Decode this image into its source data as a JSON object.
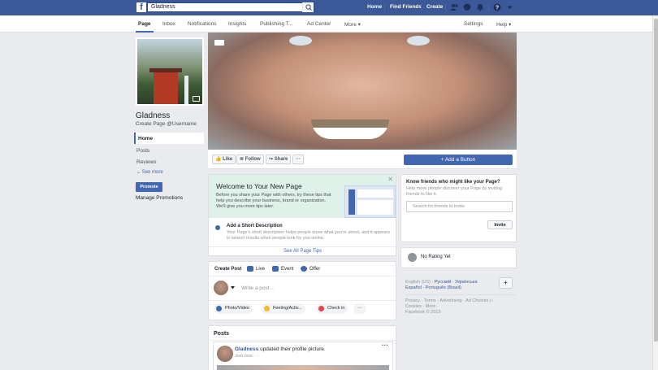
{
  "topbar": {
    "logo": "f",
    "search_value": "Gladness",
    "nav": [
      "Home",
      "Find Friends",
      "Create"
    ],
    "icons": [
      "friend-requests-icon",
      "messenger-icon",
      "notifications-icon",
      "help-icon",
      "account-menu-icon"
    ]
  },
  "subnav": {
    "tabs": [
      "Page",
      "Inbox",
      "Notifications",
      "Insights",
      "Publishing T...",
      "Ad Center",
      "More ▾"
    ],
    "settings": "Settings",
    "help": "Help ▾"
  },
  "sidebar": {
    "page_name": "Gladness",
    "username": "Create Page @Username",
    "items": [
      "Home",
      "Posts",
      "Reviews"
    ],
    "see_more": "See more",
    "promote": "Promote",
    "manage": "Manage Promotions"
  },
  "actions": {
    "like": "Like",
    "follow": "Follow",
    "share": "Share",
    "more": "···",
    "add_button": "+ Add a Button"
  },
  "welcome": {
    "title": "Welcome to Your New Page",
    "text": "Before you share your Page with others, try these tips that help you describe your business, brand or organization. We'll give you more tips later.",
    "tip_title": "Add a Short Description",
    "tip_text": "Your Page's short description helps people know what you're about, and it appears in search results when people look for you online.",
    "see_all": "See All Page Tips",
    "close": "✕"
  },
  "composer": {
    "tabs": [
      "Create Post",
      "Live",
      "Event",
      "Offer"
    ],
    "placeholder": "Write a post...",
    "options": [
      "Photo/Video",
      "Feeling/Activ...",
      "Check in",
      "···"
    ]
  },
  "posts": {
    "title": "Posts",
    "author": "Gladness",
    "action": "updated their profile picture.",
    "time": "Just now",
    "more": "···"
  },
  "right": {
    "invite_title": "Know friends who might like your Page?",
    "invite_text": "Help more people discover your Page by inviting friends to like it.",
    "search_placeholder": "Search for friends to invite",
    "invite_btn": "Invite",
    "rating": "No Rating Yet",
    "lang_line1": "English (US) · ",
    "lang_ru": "Русский",
    "lang_ua": " · Українська",
    "lang_line2": "Español · Português (Brasil)",
    "plus": "+",
    "footer1": "Privacy · Terms · Advertising · Ad Choices ▷ ·",
    "footer2": "Cookies · More ·",
    "footer3": "Facebook © 2019"
  },
  "colors": {
    "brand": "#3b5998",
    "accent": "#4267b2",
    "bg": "#e9ebee"
  }
}
